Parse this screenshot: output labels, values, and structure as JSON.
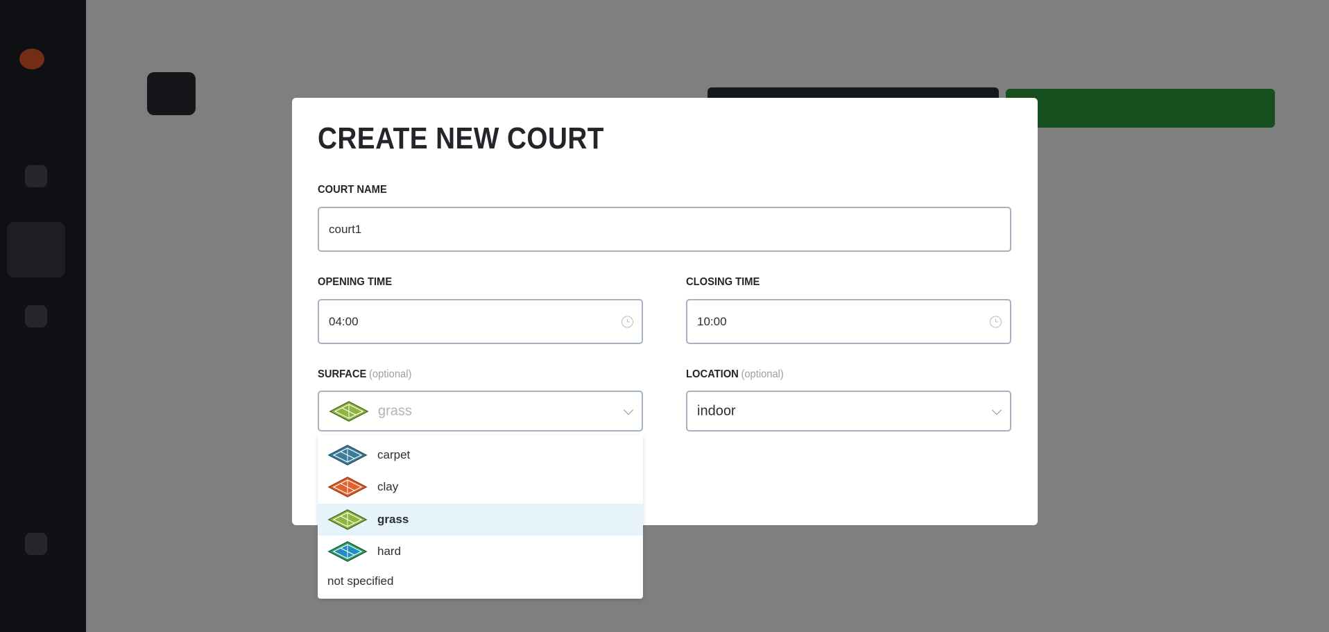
{
  "modal": {
    "title": "CREATE NEW COURT",
    "court_name": {
      "label": "COURT NAME",
      "value": "court1"
    },
    "opening_time": {
      "label": "OPENING TIME",
      "value": "04:00"
    },
    "closing_time": {
      "label": "CLOSING TIME",
      "value": "10:00"
    },
    "surface": {
      "label": "SURFACE",
      "optional": "(optional)",
      "value": "grass"
    },
    "location": {
      "label": "LOCATION",
      "optional": "(optional)",
      "value": "indoor"
    }
  },
  "surface_options": [
    {
      "label": "carpet",
      "icon": "carpet-court-icon",
      "color": "#3e7d98"
    },
    {
      "label": "clay",
      "icon": "clay-court-icon",
      "color": "#e0612a"
    },
    {
      "label": "grass",
      "icon": "grass-court-icon",
      "color": "#8fb541",
      "selected": true
    },
    {
      "label": "hard",
      "icon": "hard-court-icon",
      "color": "#1f8fbf"
    },
    {
      "label": "not specified"
    }
  ],
  "colors": {
    "overlay": "rgba(0,0,0,0.5)",
    "selected_option": "#e6f3fb",
    "input_border": "#a6b1c2"
  }
}
